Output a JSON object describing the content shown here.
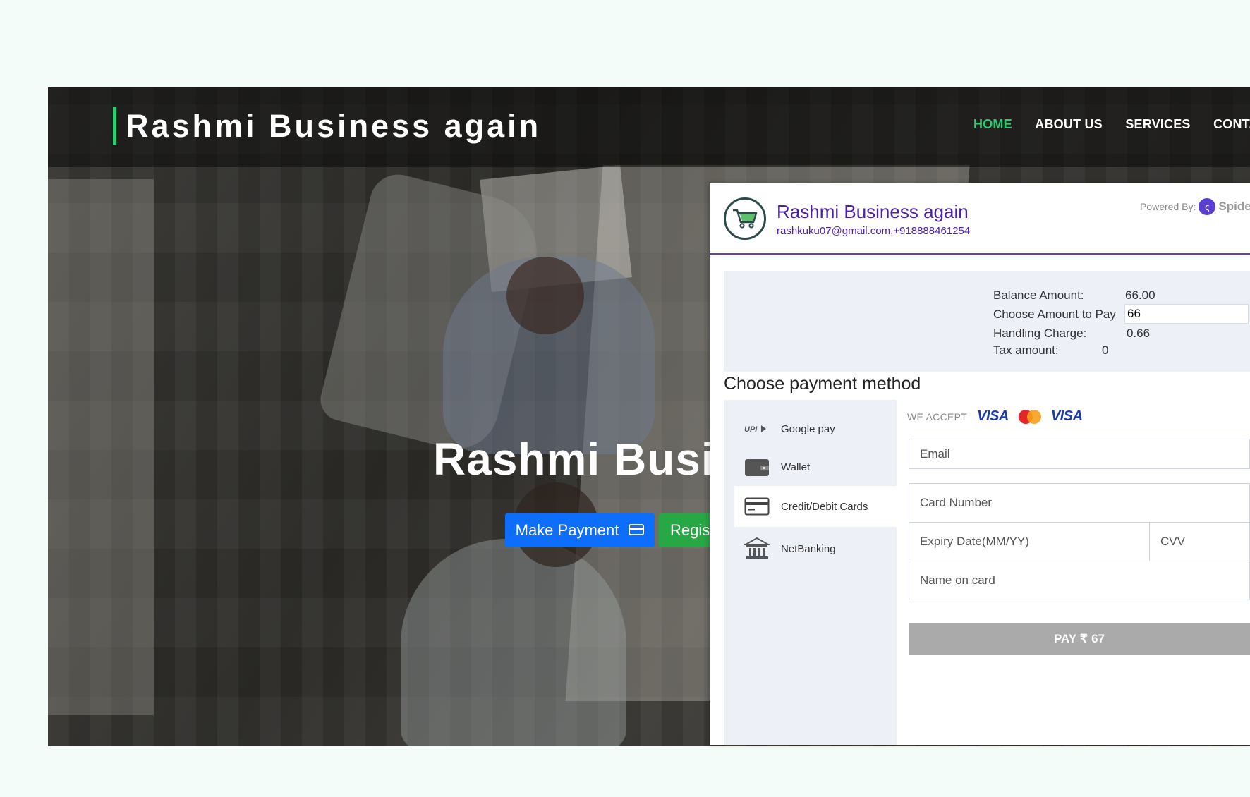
{
  "site": {
    "brand": "Rashmi Business again",
    "nav": [
      "HOME",
      "ABOUT US",
      "SERVICES",
      "CONTA"
    ],
    "hero_title": "Rashmi Busi",
    "make_payment_label": "Make Payment",
    "register_label": "Regist",
    "accent_color": "#2ecc71"
  },
  "checkout": {
    "title": "Rashmi Business again",
    "contact": "rashkuku07@gmail.com,+918888461254",
    "powered_by": "Powered By:",
    "powered_brand": "Spide",
    "summary": {
      "balance_label": "Balance Amount:",
      "balance_value": "66.00",
      "choose_label": "Choose Amount to Pay",
      "choose_value": "66",
      "handling_label": "Handling Charge:",
      "handling_value": "0.66",
      "tax_label": "Tax amount:",
      "tax_value": "0"
    },
    "choose_method_title": "Choose payment method",
    "methods": [
      {
        "label": "Google pay",
        "icon": "upi-icon"
      },
      {
        "label": "Wallet",
        "icon": "wallet-icon"
      },
      {
        "label": "Credit/Debit Cards",
        "icon": "credit-card-icon"
      },
      {
        "label": "NetBanking",
        "icon": "bank-icon"
      }
    ],
    "selected_method": "Credit/Debit Cards",
    "we_accept": "WE ACCEPT",
    "card_brands": [
      "VISA",
      "MasterCard",
      "VISA"
    ],
    "email_placeholder": "Email",
    "card_number_placeholder": "Card Number",
    "expiry_placeholder": "Expiry Date(MM/YY)",
    "cvv_placeholder": "CVV",
    "name_placeholder": "Name on card",
    "pay_label": "PAY ₹ 67",
    "theme_color": "#4b1fa8"
  }
}
